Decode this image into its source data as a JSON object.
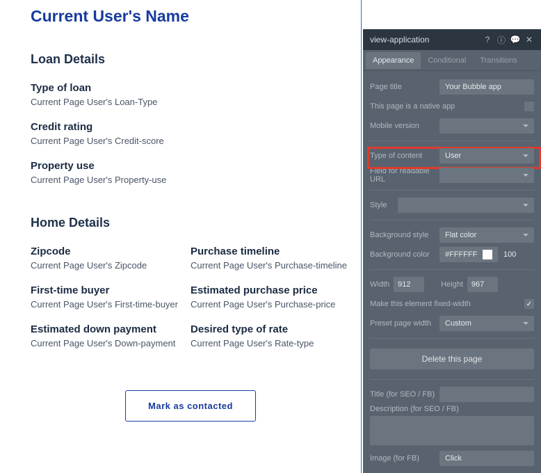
{
  "page": {
    "title": "Current User's Name",
    "loan_section": "Loan Details",
    "home_section": "Home Details",
    "fields": {
      "loan_type": {
        "label": "Type of loan",
        "value": "Current Page User's Loan-Type"
      },
      "credit_rating": {
        "label": "Credit rating",
        "value": "Current Page User's Credit-score"
      },
      "property_use": {
        "label": "Property use",
        "value": "Current Page User's Property-use"
      },
      "zipcode": {
        "label": "Zipcode",
        "value": "Current Page User's Zipcode"
      },
      "first_time": {
        "label": "First-time buyer",
        "value": "Current Page User's First-time-buyer"
      },
      "down_payment": {
        "label": "Estimated down payment",
        "value": "Current Page User's Down-payment"
      },
      "timeline": {
        "label": "Purchase timeline",
        "value": "Current Page User's Purchase-timeline"
      },
      "price": {
        "label": "Estimated purchase price",
        "value": "Current Page User's Purchase-price"
      },
      "rate_type": {
        "label": "Desired type of rate",
        "value": "Current Page User's Rate-type"
      }
    },
    "contact_btn": "Mark as contacted"
  },
  "panel": {
    "title": "view-application",
    "tabs": {
      "appearance": "Appearance",
      "conditional": "Conditional",
      "transitions": "Transitions"
    },
    "rows": {
      "page_title": {
        "label": "Page title",
        "value": "Your Bubble app"
      },
      "native_app": {
        "label": "This page is a native app"
      },
      "mobile_version": {
        "label": "Mobile version",
        "value": ""
      },
      "type_of_content": {
        "label": "Type of content",
        "value": "User"
      },
      "readable_url": {
        "label": "Field for readable URL",
        "value": ""
      },
      "style": {
        "label": "Style",
        "value": ""
      },
      "bg_style": {
        "label": "Background style",
        "value": "Flat color"
      },
      "bg_color": {
        "label": "Background color",
        "value": "#FFFFFF",
        "opacity": "100"
      },
      "width": {
        "label": "Width",
        "value": "912"
      },
      "height": {
        "label": "Height",
        "value": "967"
      },
      "fixed_width": {
        "label": "Make this element fixed-width",
        "checked": true
      },
      "preset_width": {
        "label": "Preset page width",
        "value": "Custom"
      },
      "delete": "Delete this page",
      "seo_title": {
        "label": "Title (for SEO / FB)",
        "value": ""
      },
      "seo_desc": {
        "label": "Description (for SEO / FB)"
      },
      "seo_image": {
        "label": "Image (for FB)",
        "value": "Click"
      }
    }
  }
}
